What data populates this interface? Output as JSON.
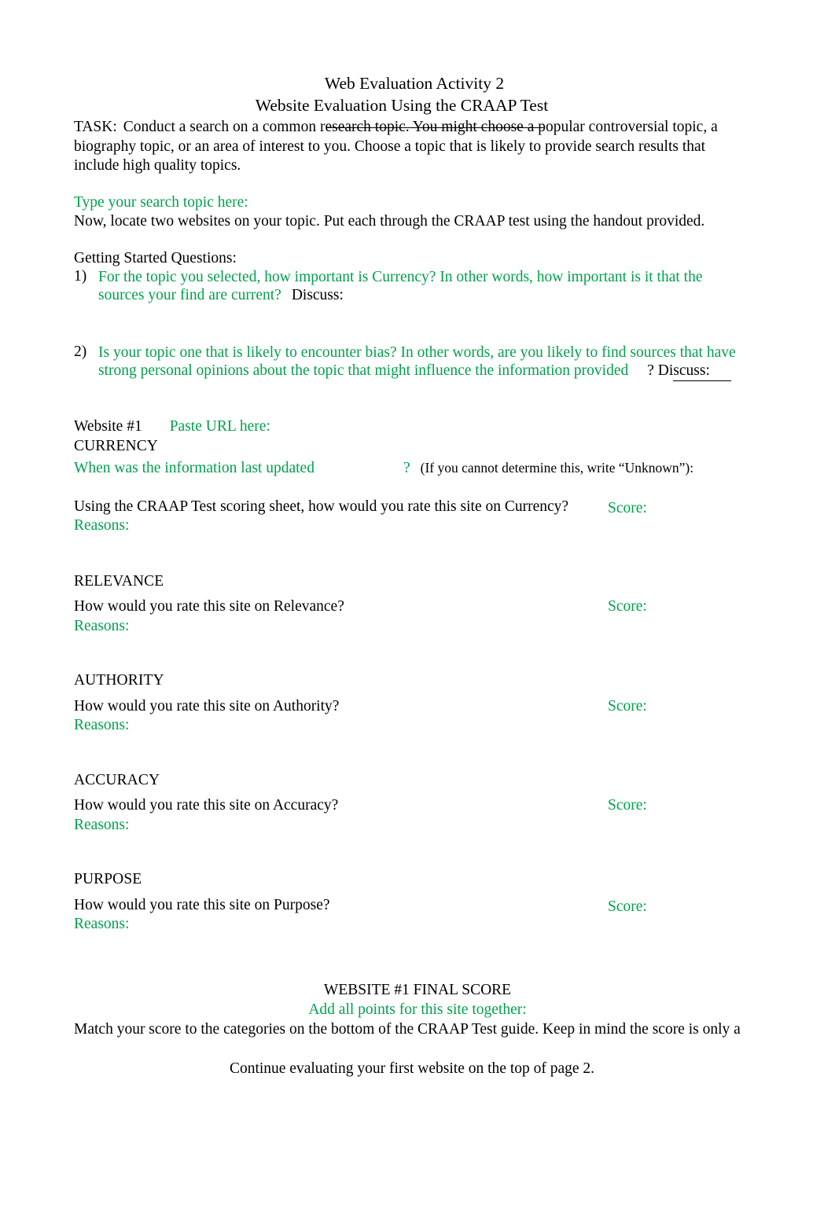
{
  "document": {
    "title_line_1": "Web Evaluation Activity 2",
    "title_line_2": "Website Evaluation Using the CRAAP Test",
    "task_label": "TASK:",
    "task_text": "Conduct a search on a common research topic. You might choose a popular controversial topic, a biography topic, or an area of interest to you.   Choose a topic that is likely to provide search results that include high quality topics.",
    "search_topic_prompt": "Type your search topic here:",
    "locate_instruction": "Now, locate two websites on your topic.   Put each through the CRAAP test using the handout provided.",
    "getting_started_heading": "Getting Started Questions:",
    "questions": [
      {
        "number": "1)",
        "green_text": "For the topic you selected, how important is Currency?    In other words, how important is it that the sources your find are current?",
        "black_text": "Discuss:"
      },
      {
        "number": "2)",
        "green_text": "Is your topic one that is likely to encounter bias?    In other words, are you likely to find sources that have strong personal opinions about the topic that might influence the information provided",
        "black_text": "?  Discuss:"
      }
    ],
    "website_label": "Website #1",
    "paste_url_label": "Paste URL here:",
    "currency": {
      "heading": "CURRENCY",
      "green_question": "When was the information last updated",
      "green_qmark": "?",
      "black_note": "(If you cannot determine this, write “Unknown”):",
      "rating_question": "Using the CRAAP Test scoring sheet, how would you rate this site on Currency?",
      "score_label": "Score:",
      "reasons_label": "Reasons:"
    },
    "sections": [
      {
        "heading": "RELEVANCE",
        "rating_question": "How would you rate this site on Relevance?",
        "score_label": "Score:",
        "reasons_label": "Reasons:"
      },
      {
        "heading": "AUTHORITY",
        "rating_question": "How would you rate this site on Authority?",
        "score_label": "Score:",
        "reasons_label": "Reasons:"
      },
      {
        "heading": "ACCURACY",
        "rating_question": "How would you rate this site on Accuracy?",
        "score_label": "Score:",
        "reasons_label": "Reasons:"
      },
      {
        "heading": "PURPOSE",
        "rating_question": "How would you rate this site on Purpose?",
        "score_label": "Score:",
        "reasons_label": "Reasons:"
      }
    ],
    "final": {
      "heading": "WEBSITE #1 FINAL SCORE",
      "add_points": "Add all points for this site together:",
      "match_text": "Match your score to the categories on the bottom of the CRAAP Test guide.   Keep in mind the score is only a",
      "continue_text": "Continue evaluating your first website on the top of page 2."
    }
  },
  "colors": {
    "green": "#00a14b",
    "black": "#000000",
    "page_background": "#ffffff"
  }
}
